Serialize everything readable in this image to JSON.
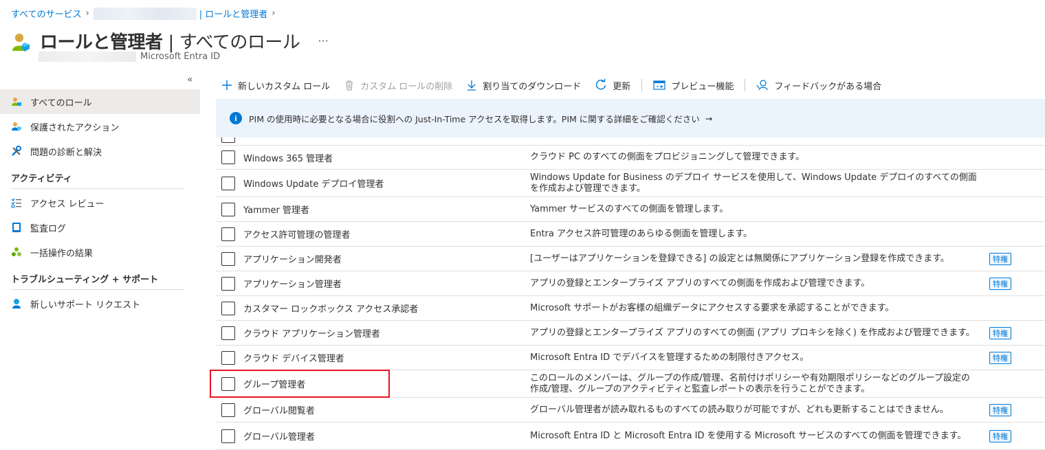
{
  "breadcrumb": {
    "item1": "すべてのサービス",
    "item2": "| ロールと管理者"
  },
  "header": {
    "title": "ロールと管理者",
    "separator": "|",
    "subtitle": "すべてのロール",
    "ellipsis": "···",
    "tenant_subtitle": "Microsoft Entra ID"
  },
  "nav": {
    "collapse": "«",
    "items": [
      {
        "label": "すべてのロール",
        "icon": "roles-icon"
      },
      {
        "label": "保護されたアクション",
        "icon": "protected-actions-icon"
      },
      {
        "label": "問題の診断と解決",
        "icon": "wrench-icon"
      }
    ],
    "section_activity": "アクティビティ",
    "activity_items": [
      {
        "label": "アクセス レビュー",
        "icon": "access-review-icon"
      },
      {
        "label": "監査ログ",
        "icon": "audit-log-icon"
      },
      {
        "label": "一括操作の結果",
        "icon": "bulk-ops-icon"
      }
    ],
    "section_support": "トラブルシューティング + サポート",
    "support_items": [
      {
        "label": "新しいサポート リクエスト",
        "icon": "support-icon"
      }
    ]
  },
  "toolbar": {
    "new_custom_role": "新しいカスタム ロール",
    "delete_custom_role": "カスタム ロールの削除",
    "download_assignments": "割り当てのダウンロード",
    "refresh": "更新",
    "preview_features": "プレビュー機能",
    "feedback": "フィードバックがある場合"
  },
  "banner": {
    "text": "PIM の使用時に必要となる場合に役割への Just-In-Time アクセスを取得します。PIM に関する詳細をご確認ください",
    "arrow": "→"
  },
  "table": {
    "privileged_label": "特権",
    "rows": [
      {
        "name": "Windows 365 管理者",
        "desc": "クラウド PC のすべての側面をプロビジョニングして管理できます。",
        "privileged": false
      },
      {
        "name": "Windows Update デプロイ管理者",
        "desc": "Windows Update for Business のデプロイ サービスを使用して、Windows Update デプロイのすべての側面を作成および管理できます。",
        "privileged": false
      },
      {
        "name": "Yammer 管理者",
        "desc": "Yammer サービスのすべての側面を管理します。",
        "privileged": false
      },
      {
        "name": "アクセス許可管理の管理者",
        "desc": "Entra アクセス許可管理のあらゆる側面を管理します。",
        "privileged": false
      },
      {
        "name": "アプリケーション開発者",
        "desc": "[ユーザーはアプリケーションを登録できる] の設定とは無関係にアプリケーション登録を作成できます。",
        "privileged": true
      },
      {
        "name": "アプリケーション管理者",
        "desc": "アプリの登録とエンタープライズ アプリのすべての側面を作成および管理できます。",
        "privileged": true
      },
      {
        "name": "カスタマー ロックボックス アクセス承認者",
        "desc": "Microsoft サポートがお客様の組織データにアクセスする要求を承認することができます。",
        "privileged": false
      },
      {
        "name": "クラウド アプリケーション管理者",
        "desc": "アプリの登録とエンタープライズ アプリのすべての側面 (アプリ プロキシを除く) を作成および管理できます。",
        "privileged": true
      },
      {
        "name": "クラウド デバイス管理者",
        "desc": "Microsoft Entra ID でデバイスを管理するための制限付きアクセス。",
        "privileged": true
      },
      {
        "name": "グループ管理者",
        "desc": "このロールのメンバーは、グループの作成/管理、名前付けポリシーや有効期限ポリシーなどのグループ設定の作成/管理、グループのアクティビティと監査レポートの表示を行うことができます。",
        "privileged": false
      },
      {
        "name": "グローバル閲覧者",
        "desc": "グローバル管理者が読み取れるものすべての読み取りが可能ですが、どれも更新することはできません。",
        "privileged": true
      },
      {
        "name": "グローバル管理者",
        "desc": "Microsoft Entra ID と Microsoft Entra ID を使用する Microsoft サービスのすべての側面を管理できます。",
        "privileged": true
      }
    ]
  }
}
